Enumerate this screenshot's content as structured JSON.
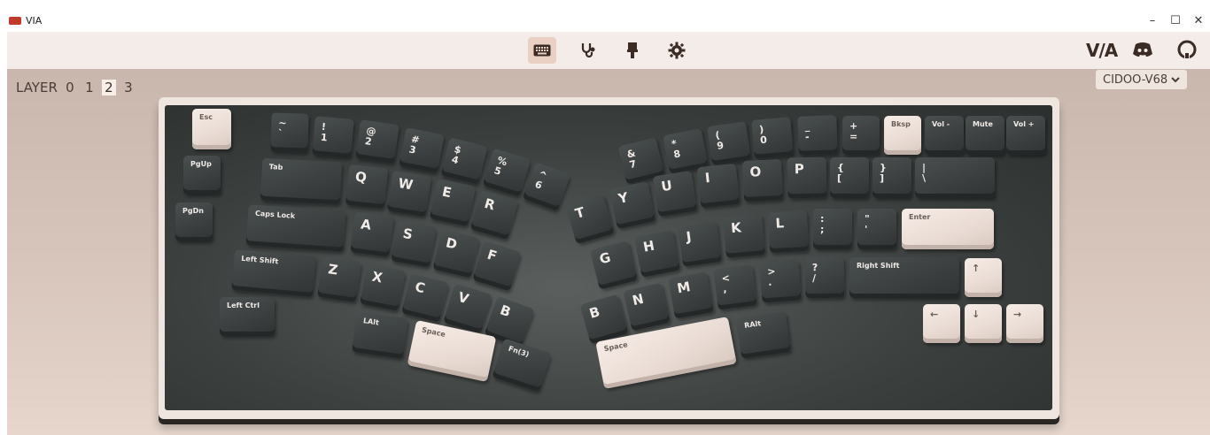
{
  "window": {
    "title": "VIA",
    "controls": {
      "minimize": "–",
      "maximize": "☐",
      "close": "✕"
    }
  },
  "toolbar": {
    "tabs": [
      {
        "name": "configure",
        "icon": "keyboard-icon",
        "active": true
      },
      {
        "name": "test",
        "icon": "stethoscope-icon",
        "active": false
      },
      {
        "name": "design",
        "icon": "paintbrush-icon",
        "active": false
      },
      {
        "name": "settings",
        "icon": "gear-icon",
        "active": false
      }
    ],
    "right": {
      "via_logo": "V/A",
      "discord": "discord-icon",
      "github": "github-icon"
    }
  },
  "layers": {
    "label": "LAYER",
    "items": [
      "0",
      "1",
      "2",
      "3"
    ],
    "active": "2"
  },
  "device_selector": {
    "value": "CIDOO-V68",
    "icon": "chevron-down-icon"
  },
  "keyboard": {
    "name": "CIDOO-V68",
    "keys": {
      "esc": "Esc",
      "pgup": "PgUp",
      "pgdn": "PgDn",
      "grave": "~\n`",
      "k1": "!\n1",
      "k2": "@\n2",
      "k3": "#\n3",
      "k4": "$\n4",
      "k5": "%\n5",
      "k6": "^\n6",
      "k7": "&\n7",
      "k8": "*\n8",
      "k9": "(\n9",
      "k0": ")\n0",
      "minus": "_\n-",
      "equal": "+\n=",
      "bksp": "Bksp",
      "voldown": "Vol -",
      "mute": "Mute",
      "volup": "Vol +",
      "tab": "Tab",
      "q": "Q",
      "w": "W",
      "e": "E",
      "r": "R",
      "t": "T",
      "y": "Y",
      "u": "U",
      "i": "I",
      "o": "O",
      "p": "P",
      "lbracket": "{\n[",
      "rbracket": "}\n]",
      "backslash": "|\n\\",
      "caps": "Caps Lock",
      "a": "A",
      "s": "S",
      "d": "D",
      "f": "F",
      "g": "G",
      "h": "H",
      "j": "J",
      "k": "K",
      "l": "L",
      "semicolon": ":\n;",
      "quote": "\"\n'",
      "enter": "Enter",
      "lshift": "Left Shift",
      "z": "Z",
      "x": "X",
      "c": "C",
      "v": "V",
      "b": "B",
      "b2": "B",
      "n": "N",
      "m": "M",
      "comma": "<\n,",
      "period": ">\n.",
      "slash": "?\n/",
      "rshift": "Right Shift",
      "up": "↑",
      "lctrl": "Left Ctrl",
      "lalt": "LAlt",
      "space_l": "Space",
      "fn": "Fn(3)",
      "space_r": "Space",
      "ralt": "RAlt",
      "left": "←",
      "down": "↓",
      "right": "→"
    }
  }
}
